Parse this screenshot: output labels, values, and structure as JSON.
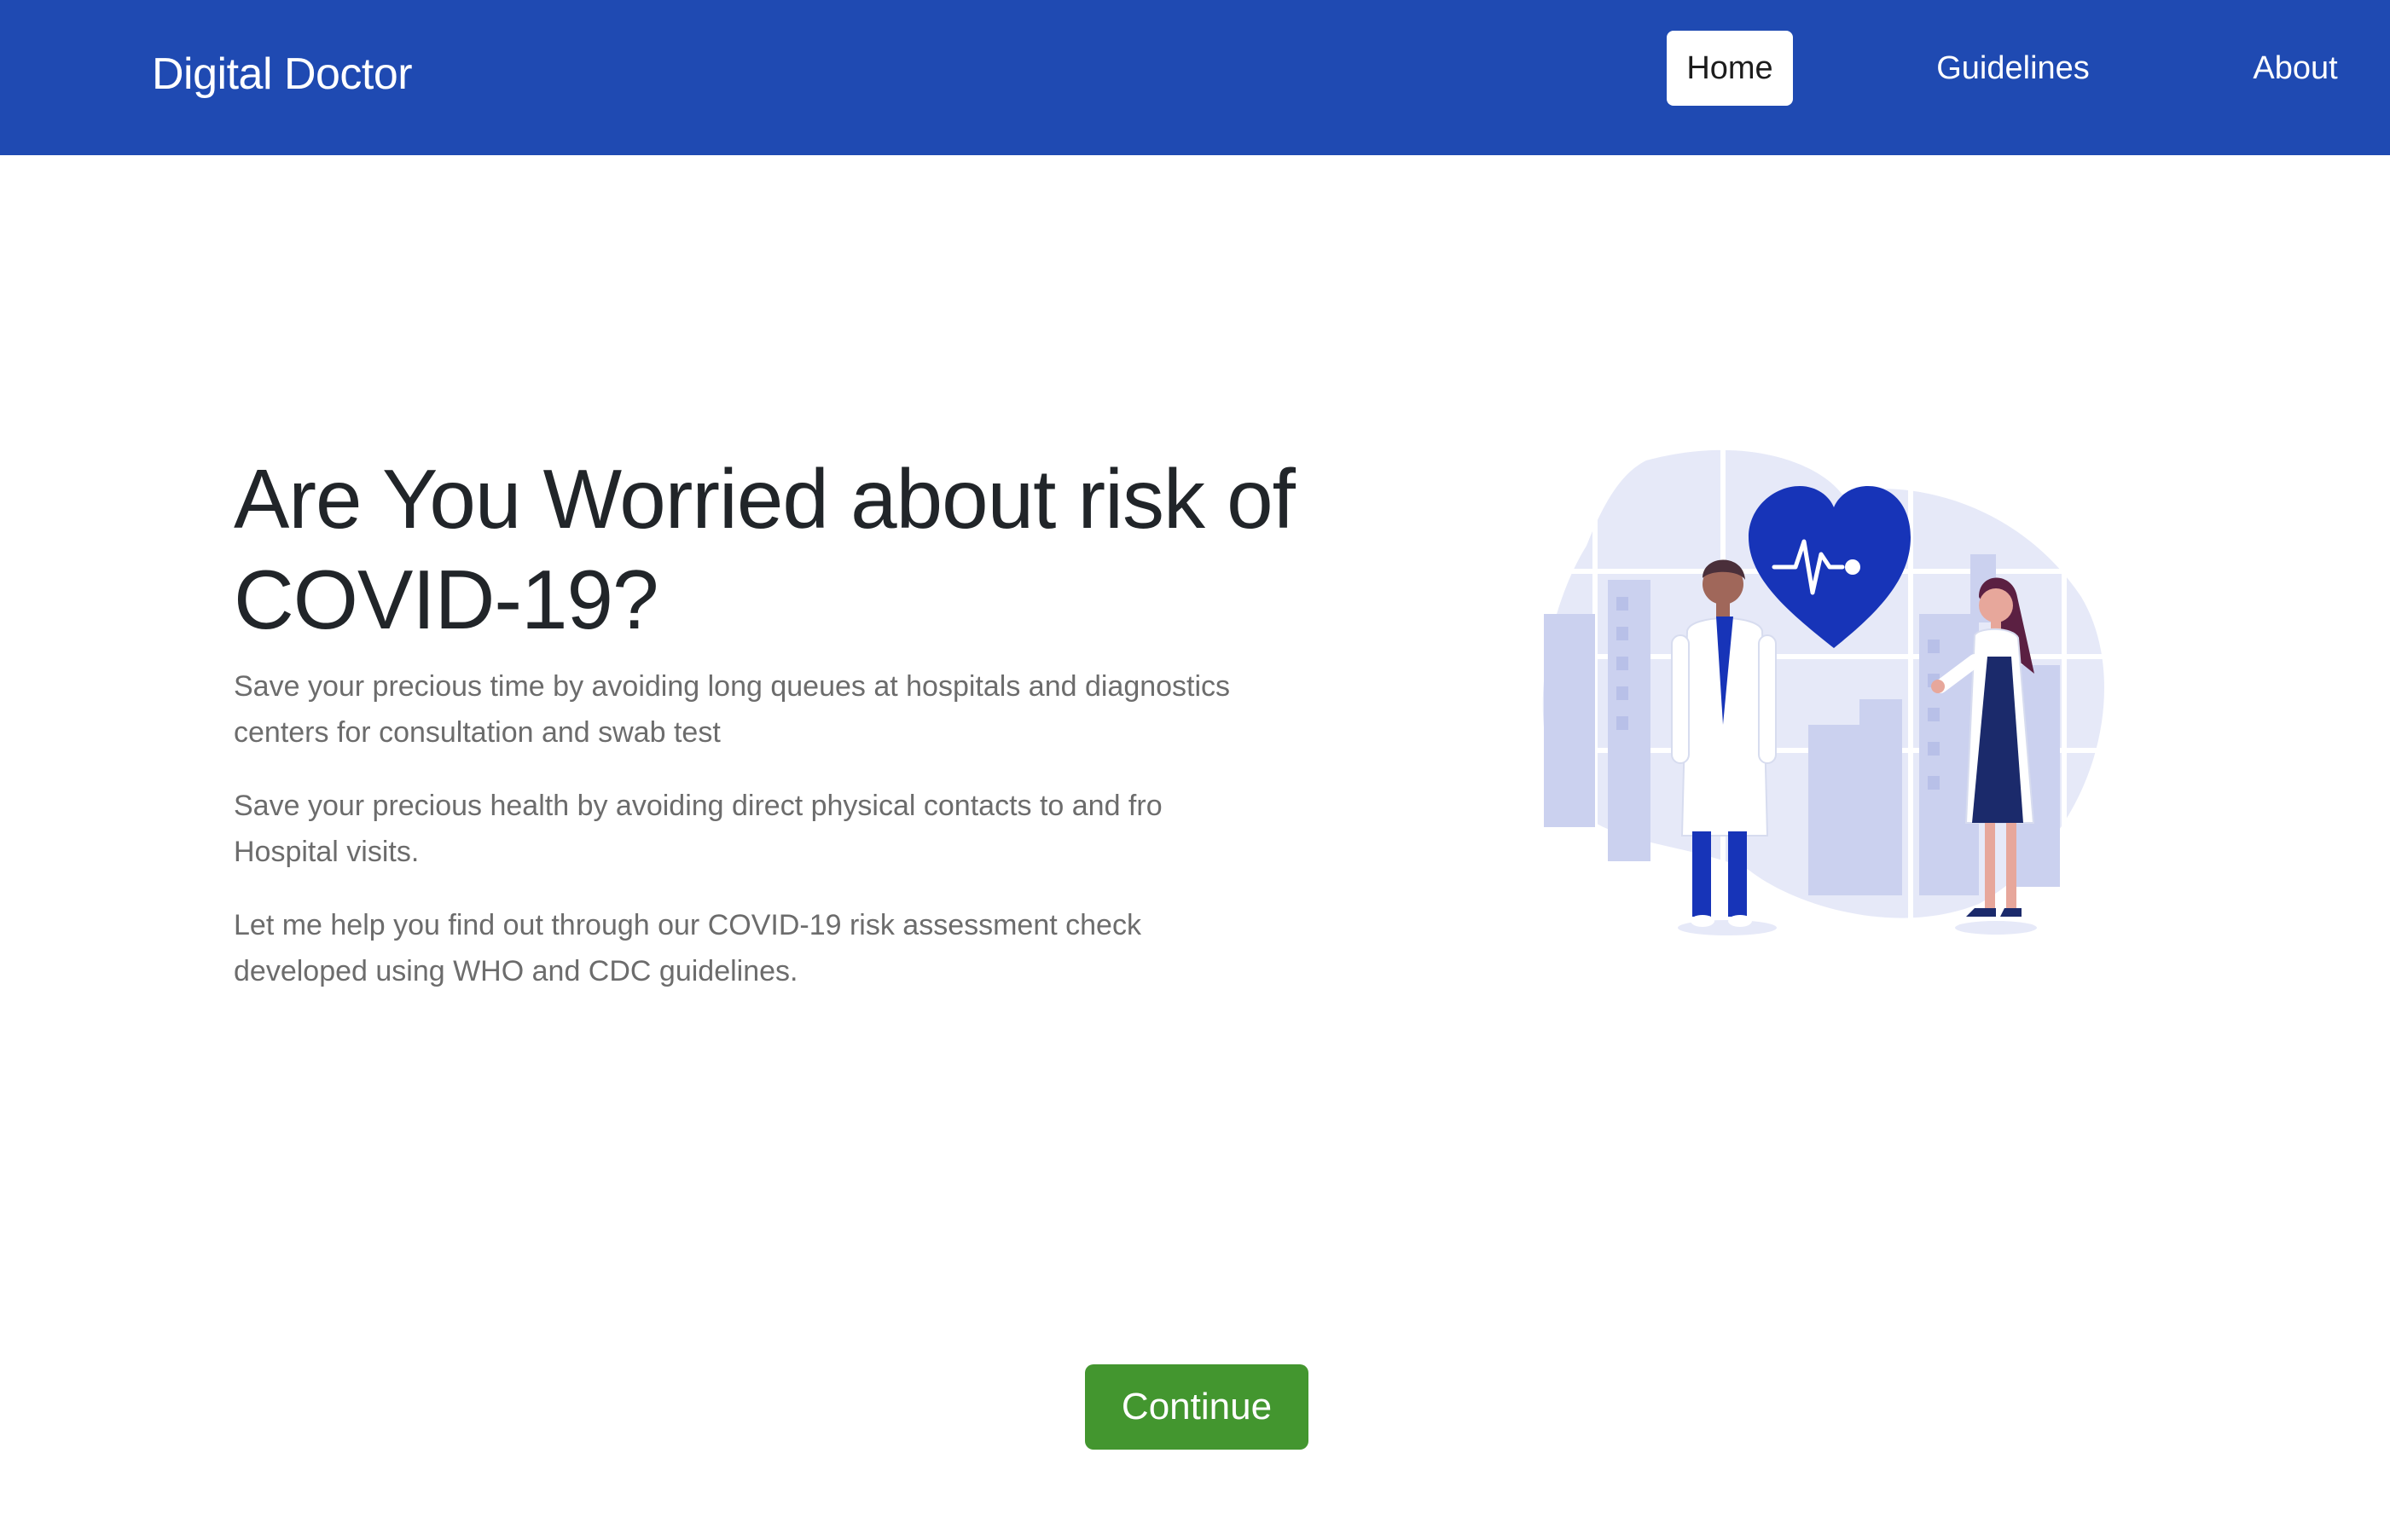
{
  "header": {
    "brand": "Digital Doctor",
    "nav": {
      "home": "Home",
      "guidelines": "Guidelines",
      "about": "About"
    }
  },
  "hero": {
    "title": "Are You Worried about risk of COVID-19?",
    "paragraphs": [
      "Save your precious time by avoiding long queues at hospitals and diagnostics centers for consultation and swab test",
      "Save your precious health by avoiding direct physical contacts to and fro Hospital visits.",
      "Let me help you find out through our COVID-19 risk assessment check developed using WHO and CDC guidelines."
    ]
  },
  "actions": {
    "continue_label": "Continue"
  },
  "colors": {
    "navbar": "#1f4ab2",
    "continue_button": "#43962f",
    "heart": "#1734b8"
  },
  "illustration": {
    "icons": [
      "heart-pulse-icon",
      "doctor-male-figure",
      "doctor-female-figure"
    ]
  }
}
